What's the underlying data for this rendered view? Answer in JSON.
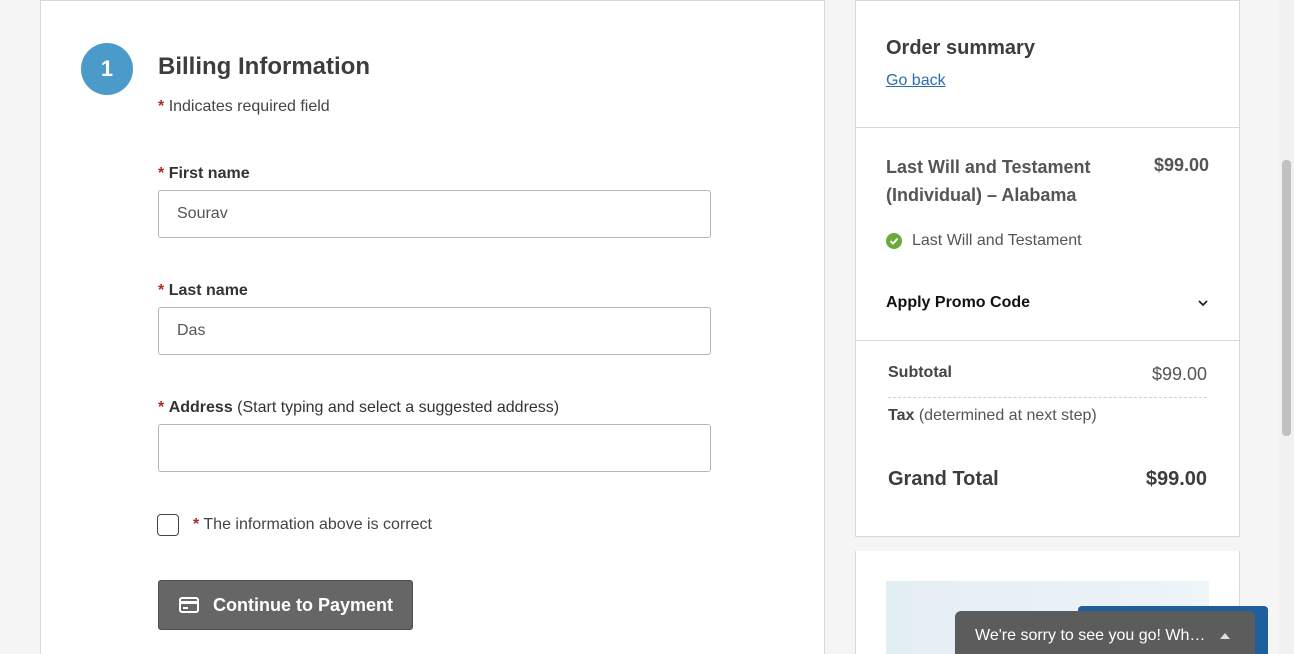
{
  "billing": {
    "step_number": "1",
    "title": "Billing Information",
    "required_marker": "*",
    "required_note": "Indicates required field",
    "first_name": {
      "label": "First name",
      "value": "Sourav"
    },
    "last_name": {
      "label": "Last name",
      "value": "Das"
    },
    "address": {
      "label": "Address",
      "hint": "(Start typing and select a suggested address)",
      "value": ""
    },
    "confirm_checkbox": {
      "label": "The information above is correct",
      "checked": false
    },
    "continue_button": {
      "label": "Continue to Payment",
      "icon": "credit-card-icon"
    }
  },
  "summary": {
    "title": "Order summary",
    "go_back": "Go back",
    "product": {
      "name": "Last Will and Testament (Individual) – Alabama",
      "price": "$99.00"
    },
    "included_item": "Last Will and Testament",
    "promo_label": "Apply Promo Code",
    "subtotal_label": "Subtotal",
    "subtotal_value": "$99.00",
    "tax_label": "Tax",
    "tax_note": "(determined at next step)",
    "grand_total_label": "Grand Total",
    "grand_total_value": "$99.00"
  },
  "toast": {
    "text": "We're sorry to see you go! What made you want to leave?"
  },
  "colors": {
    "step_circle": "#4a9bc9",
    "required_star": "#b02a1e",
    "button_bg": "#666666",
    "link": "#2a6eb3",
    "check_green": "#6aaa3a"
  }
}
